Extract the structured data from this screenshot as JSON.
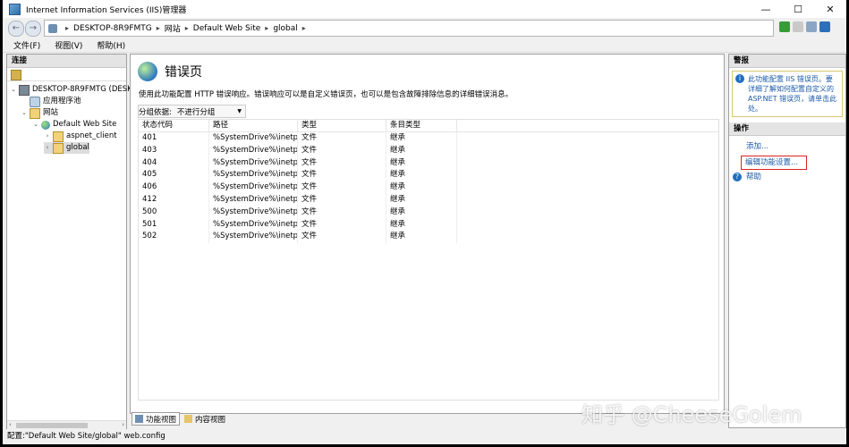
{
  "window": {
    "title": "Internet Information Services (IIS)管理器",
    "controls": [
      "—",
      "☐",
      "✕"
    ]
  },
  "address": {
    "crumbs": [
      "DESKTOP-8R9FMTG",
      "网站",
      "Default Web Site",
      "global"
    ]
  },
  "menu": [
    "文件(F)",
    "视图(V)",
    "帮助(H)"
  ],
  "connections": {
    "title": "连接",
    "tree": [
      {
        "label": "DESKTOP-8R9FMTG (DESK",
        "twisty": "⌄",
        "icon": "computer-icon"
      },
      {
        "label": "应用程序池",
        "twisty": "",
        "icon": "app-pool-icon"
      },
      {
        "label": "网站",
        "twisty": "⌄",
        "icon": "folder-icon"
      },
      {
        "label": "Default Web Site",
        "twisty": "⌄",
        "icon": "globe-icon"
      },
      {
        "label": "aspnet_client",
        "twisty": "›",
        "icon": "folder-icon"
      },
      {
        "label": "global",
        "twisty": "›",
        "icon": "folder-icon"
      }
    ]
  },
  "main": {
    "title": "错误页",
    "description": "使用此功能配置 HTTP 错误响应。错误响应可以是自定义错误页，也可以是包含故障排除信息的详细错误消息。",
    "group_label": "分组依据:",
    "group_value": "不进行分组",
    "columns": [
      "状态代码",
      "路径",
      "类型",
      "条目类型"
    ],
    "rows": [
      [
        "401",
        "%SystemDrive%\\inetp...",
        "文件",
        "继承"
      ],
      [
        "403",
        "%SystemDrive%\\inetp...",
        "文件",
        "继承"
      ],
      [
        "404",
        "%SystemDrive%\\inetp...",
        "文件",
        "继承"
      ],
      [
        "405",
        "%SystemDrive%\\inetp...",
        "文件",
        "继承"
      ],
      [
        "406",
        "%SystemDrive%\\inetp...",
        "文件",
        "继承"
      ],
      [
        "412",
        "%SystemDrive%\\inetp...",
        "文件",
        "继承"
      ],
      [
        "500",
        "%SystemDrive%\\inetp...",
        "文件",
        "继承"
      ],
      [
        "501",
        "%SystemDrive%\\inetp...",
        "文件",
        "继承"
      ],
      [
        "502",
        "%SystemDrive%\\inetp...",
        "文件",
        "继承"
      ]
    ],
    "tabs": [
      "功能视图",
      "内容视图"
    ]
  },
  "alerts": {
    "title": "警报",
    "text": "此功能配置 IIS 错误页。要详细了解如何配置自定义的 ASP.NET 错误页，请单击此处。"
  },
  "actions": {
    "title": "操作",
    "add": "添加...",
    "edit_feature": "编辑功能设置...",
    "help": "帮助"
  },
  "status": {
    "text": "配置:\"Default Web Site/global\" web.config"
  },
  "watermark": "知乎 @CheeseGolem",
  "colors": {
    "link": "#1b5aa8",
    "highlight_box": "#dd2222"
  }
}
